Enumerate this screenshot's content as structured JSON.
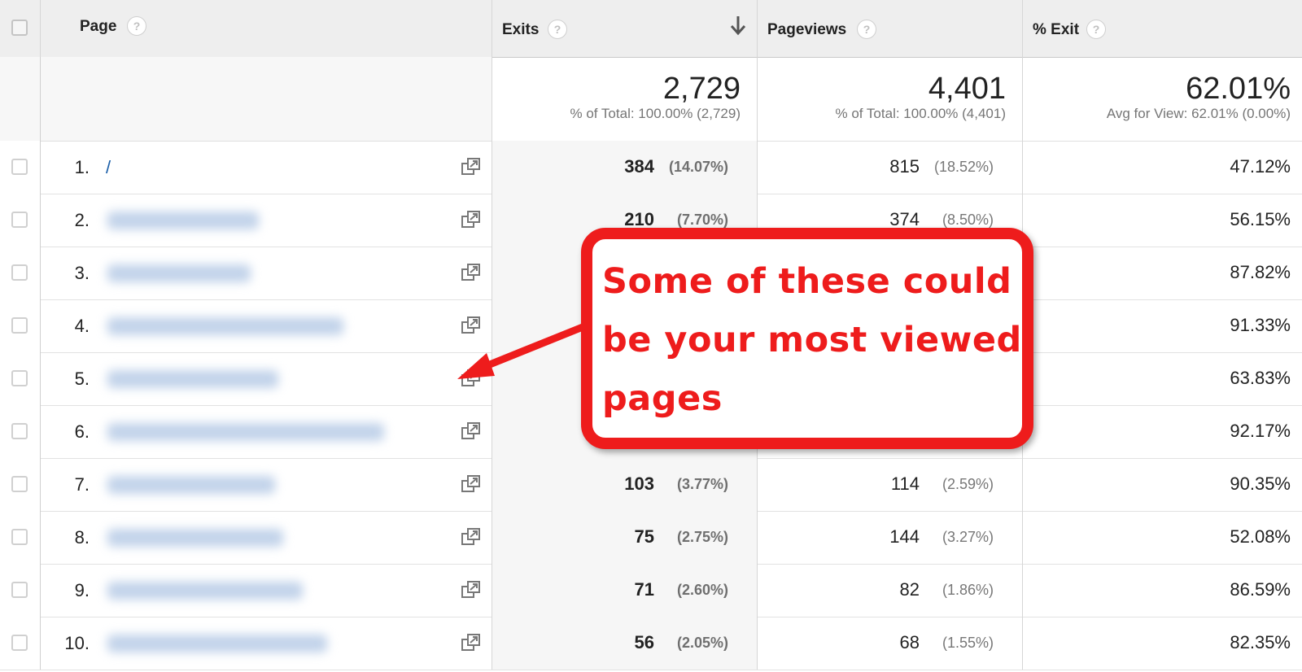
{
  "header": {
    "page_label": "Page",
    "exits_label": "Exits",
    "pageviews_label": "Pageviews",
    "exit_rate_label": "% Exit",
    "help_glyph": "?"
  },
  "totals": {
    "exits": "2,729",
    "exits_sub": "% of Total: 100.00% (2,729)",
    "pageviews": "4,401",
    "pageviews_sub": "% of Total: 100.00% (4,401)",
    "exit_rate": "62.01%",
    "exit_rate_sub": "Avg for View: 62.01% (0.00%)"
  },
  "rows": [
    {
      "rank": "1.",
      "page": "/",
      "exits": "384",
      "exits_pct": "(14.07%)",
      "pageviews": "815",
      "pageviews_pct": "(18.52%)",
      "exit_rate": "47.12%"
    },
    {
      "rank": "2.",
      "page": "",
      "exits": "210",
      "exits_pct": "(7.70%)",
      "pageviews": "374",
      "pageviews_pct": "(8.50%)",
      "exit_rate": "56.15%"
    },
    {
      "rank": "3.",
      "page": "",
      "exits": "",
      "exits_pct": "",
      "pageviews": "",
      "pageviews_pct": "",
      "exit_rate": "87.82%"
    },
    {
      "rank": "4.",
      "page": "",
      "exits": "",
      "exits_pct": "",
      "pageviews": "",
      "pageviews_pct": "",
      "exit_rate": "91.33%"
    },
    {
      "rank": "5.",
      "page": "",
      "exits": "",
      "exits_pct": "",
      "pageviews": "",
      "pageviews_pct": "",
      "exit_rate": "63.83%"
    },
    {
      "rank": "6.",
      "page": "",
      "exits": "",
      "exits_pct": "",
      "pageviews": "",
      "pageviews_pct": "",
      "exit_rate": "92.17%"
    },
    {
      "rank": "7.",
      "page": "",
      "exits": "103",
      "exits_pct": "(3.77%)",
      "pageviews": "114",
      "pageviews_pct": "(2.59%)",
      "exit_rate": "90.35%"
    },
    {
      "rank": "8.",
      "page": "",
      "exits": "75",
      "exits_pct": "(2.75%)",
      "pageviews": "144",
      "pageviews_pct": "(3.27%)",
      "exit_rate": "52.08%"
    },
    {
      "rank": "9.",
      "page": "",
      "exits": "71",
      "exits_pct": "(2.60%)",
      "pageviews": "82",
      "pageviews_pct": "(1.86%)",
      "exit_rate": "86.59%"
    },
    {
      "rank": "10.",
      "page": "",
      "exits": "56",
      "exits_pct": "(2.05%)",
      "pageviews": "68",
      "pageviews_pct": "(1.55%)",
      "exit_rate": "82.35%"
    }
  ],
  "callout": {
    "line1": "Some of these could",
    "line2": "be your most viewed",
    "line3": "pages",
    "color": "#ee1c1c"
  },
  "icons": {
    "row_open": "open-in-new-window-icon",
    "sort": "sort-descending-arrow-icon",
    "help": "help-question-icon"
  },
  "colors": {
    "link": "#1a5ea8",
    "header_bg": "#eeeeee",
    "annotation_red": "#ee1c1c"
  }
}
